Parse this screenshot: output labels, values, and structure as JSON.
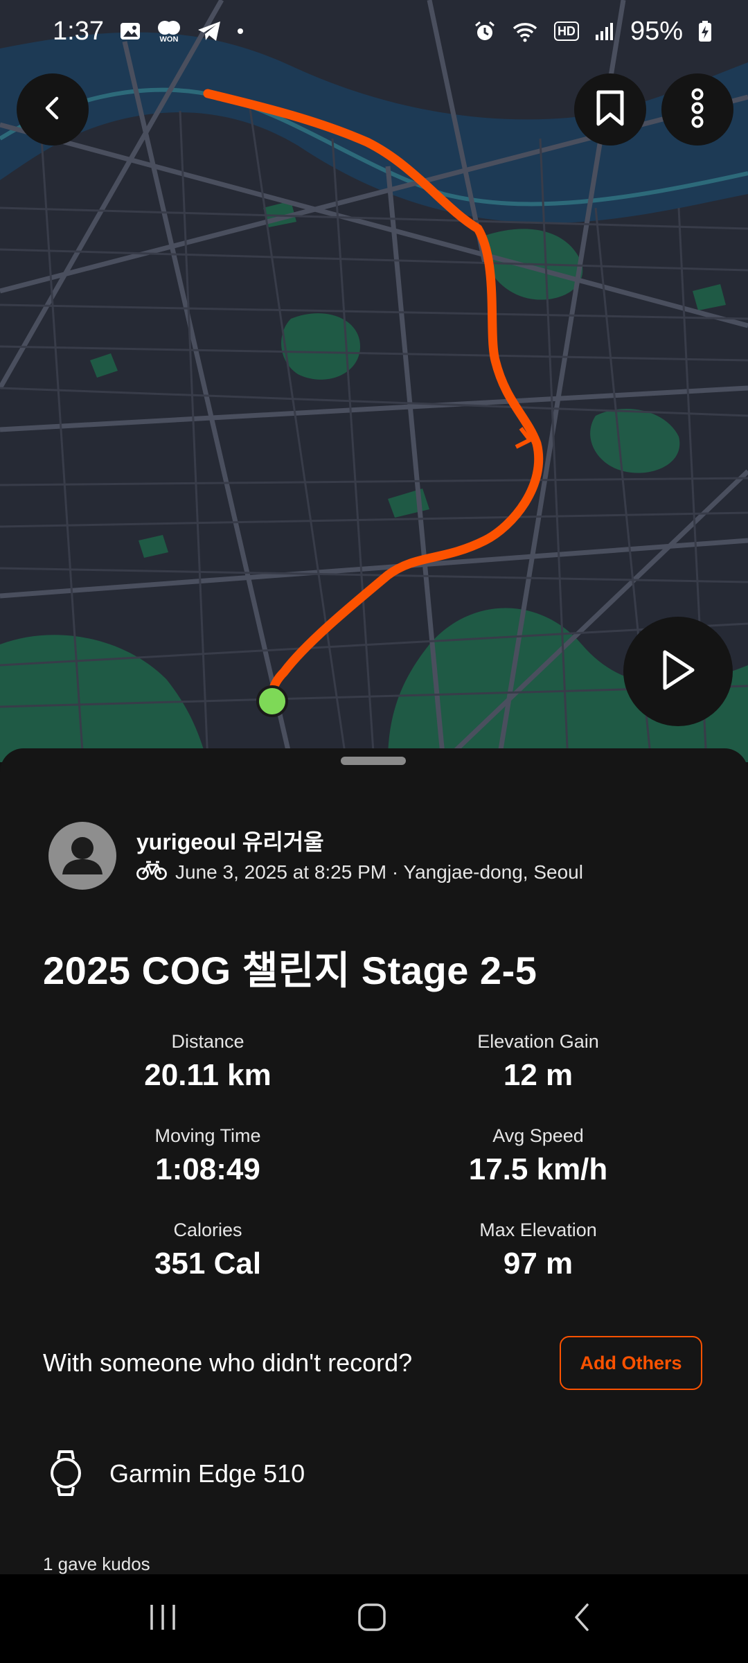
{
  "status_bar": {
    "time": "1:37",
    "battery": "95%",
    "icons": [
      "gallery-icon",
      "won-app-icon",
      "telegram-icon",
      "dot-icon",
      "alarm-icon",
      "wifi-icon",
      "hd-icon",
      "signal-icon",
      "battery-charging-icon"
    ],
    "won_label": "WON",
    "hd_label": "HD"
  },
  "map": {
    "route_color": "#fc5200",
    "start_marker_color": "#7ed957",
    "buttons": [
      "back-icon",
      "bookmark-icon",
      "more-icon",
      "play-icon"
    ]
  },
  "athlete": {
    "name": "yurigeoul 유리거울",
    "activity_icon": "bike-icon",
    "date_location": "June 3, 2025 at 8:25 PM · Yangjae-dong, Seoul"
  },
  "activity": {
    "title": "2025 COG 챌린지 Stage 2-5"
  },
  "stats": [
    {
      "label": "Distance",
      "value": "20.11 km"
    },
    {
      "label": "Elevation Gain",
      "value": "12 m"
    },
    {
      "label": "Moving Time",
      "value": "1:08:49"
    },
    {
      "label": "Avg Speed",
      "value": "17.5 km/h"
    },
    {
      "label": "Calories",
      "value": "351 Cal"
    },
    {
      "label": "Max Elevation",
      "value": "97 m"
    }
  ],
  "together": {
    "prompt": "With someone who didn't record?",
    "button_label": "Add Others"
  },
  "device": {
    "icon": "watch-icon",
    "name": "Garmin Edge 510"
  },
  "kudos": "1 gave kudos",
  "nav_bar": [
    "recents-icon",
    "home-icon",
    "back-nav-icon"
  ],
  "colors": {
    "accent": "#fc5200",
    "background": "#121212"
  }
}
